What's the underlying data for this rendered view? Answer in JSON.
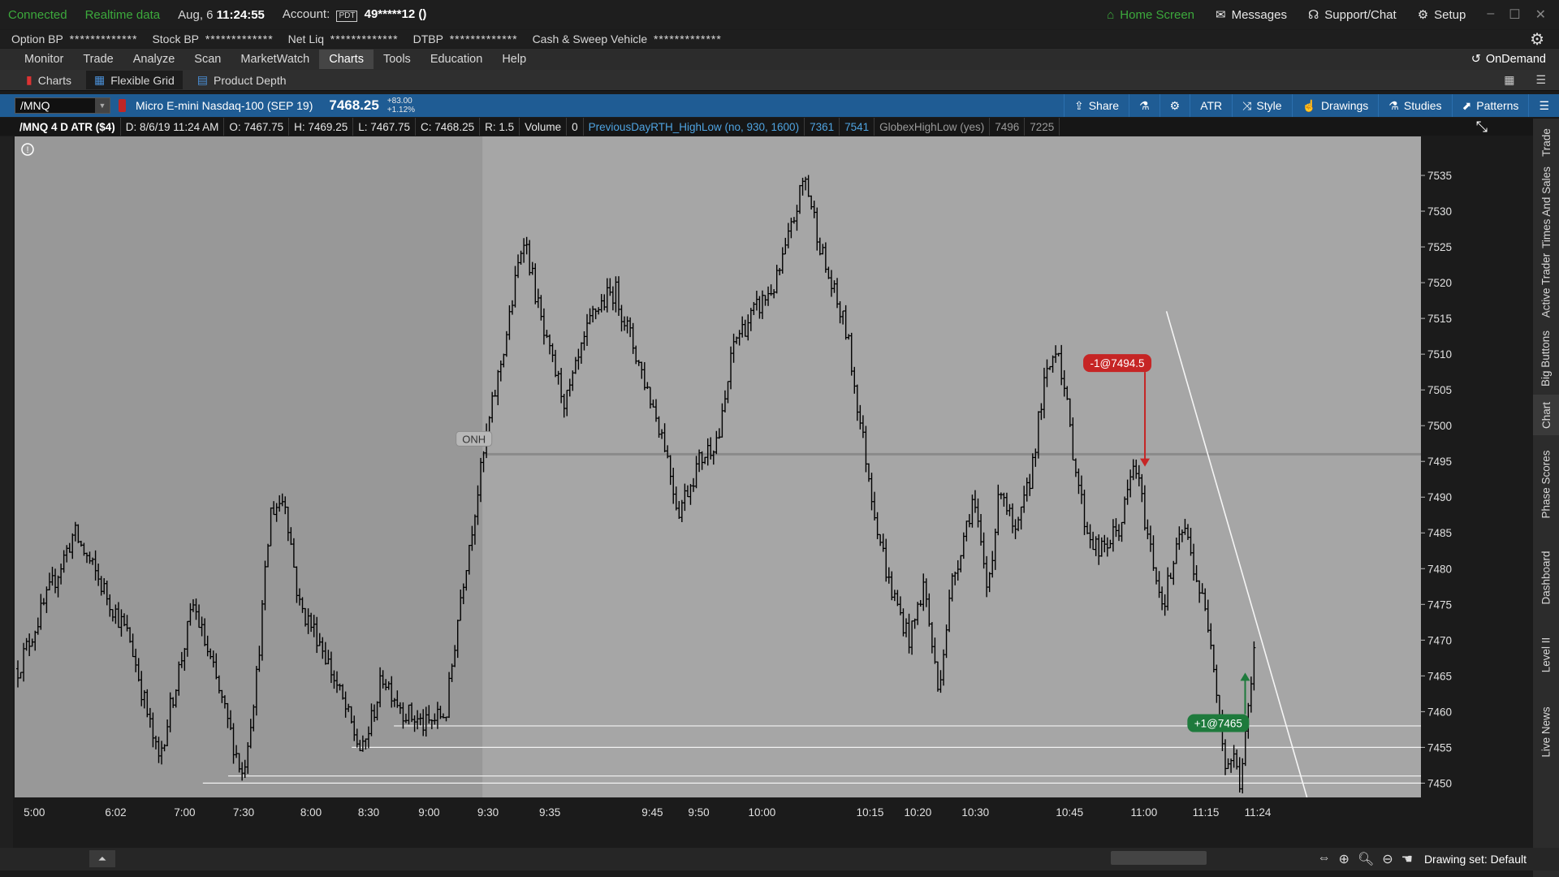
{
  "titlebar": {
    "connected": "Connected",
    "realtime": "Realtime data",
    "date": "Aug, 6",
    "time": "11:24:55",
    "account_label": "Account:",
    "pdt": "PDT",
    "account_value": "49*****12 ()",
    "home_screen": "Home Screen",
    "messages": "Messages",
    "support": "Support/Chat",
    "setup": "Setup"
  },
  "bpbar": {
    "items": [
      {
        "label": "Option BP",
        "value": "*************"
      },
      {
        "label": "Stock BP",
        "value": "*************"
      },
      {
        "label": "Net Liq",
        "value": "*************"
      },
      {
        "label": "DTBP",
        "value": "*************"
      },
      {
        "label": "Cash & Sweep Vehicle",
        "value": "*************"
      }
    ]
  },
  "nav": {
    "tabs": [
      "Monitor",
      "Trade",
      "Analyze",
      "Scan",
      "MarketWatch",
      "Charts",
      "Tools",
      "Education",
      "Help"
    ],
    "active": "Charts",
    "ondemand": "OnDemand"
  },
  "subnav": {
    "items": [
      "Charts",
      "Flexible Grid",
      "Product Depth"
    ],
    "active": "Flexible Grid"
  },
  "symbol": {
    "ticker": "/MNQ",
    "description": "Micro E-mini Nasdaq-100 (SEP 19)",
    "price": "7468.25",
    "change": "+83.00",
    "change_pct": "+1.12%",
    "tools": [
      "Share",
      "ATR",
      "Style",
      "Drawings",
      "Studies",
      "Patterns"
    ]
  },
  "info": {
    "title": "/MNQ 4 D ATR ($4)",
    "date": "D: 8/6/19 11:24 AM",
    "open": "O: 7467.75",
    "high": "H: 7469.25",
    "low": "L: 7467.75",
    "close": "C: 7468.25",
    "range": "R: 1.5",
    "volume_label": "Volume",
    "volume_value": "0",
    "study1": "PreviousDayRTH_HighLow (no, 930, 1600)",
    "study1_v1": "7361",
    "study1_v2": "7541",
    "study2": "GlobexHighLow (yes)",
    "study2_v1": "7496",
    "study2_v2": "7225"
  },
  "chart_data": {
    "type": "bar",
    "title": "",
    "y_ticks": [
      7450,
      7455,
      7460,
      7465,
      7470,
      7475,
      7480,
      7485,
      7490,
      7495,
      7500,
      7505,
      7510,
      7515,
      7520,
      7525,
      7530,
      7535
    ],
    "ylim": [
      7448,
      7540
    ],
    "x_ticks": [
      "5:00",
      "6:02",
      "7:00",
      "7:30",
      "8:00",
      "8:30",
      "9:00",
      "9:30",
      "9:35",
      "9:45",
      "9:50",
      "10:00",
      "10:15",
      "10:20",
      "10:30",
      "10:45",
      "11:00",
      "11:15",
      "11:24"
    ],
    "price_path": [
      [
        0,
        7466
      ],
      [
        0.04,
        7485
      ],
      [
        0.08,
        7470
      ],
      [
        0.1,
        7453
      ],
      [
        0.125,
        7475
      ],
      [
        0.14,
        7465
      ],
      [
        0.16,
        7451
      ],
      [
        0.17,
        7465
      ],
      [
        0.18,
        7488
      ],
      [
        0.19,
        7490
      ],
      [
        0.2,
        7475
      ],
      [
        0.215,
        7470
      ],
      [
        0.23,
        7462
      ],
      [
        0.245,
        7454
      ],
      [
        0.26,
        7465
      ],
      [
        0.275,
        7460
      ],
      [
        0.29,
        7458
      ],
      [
        0.305,
        7460
      ],
      [
        0.315,
        7476
      ],
      [
        0.325,
        7488
      ],
      [
        0.335,
        7500
      ],
      [
        0.35,
        7515
      ],
      [
        0.36,
        7527
      ],
      [
        0.375,
        7512
      ],
      [
        0.39,
        7503
      ],
      [
        0.41,
        7516
      ],
      [
        0.425,
        7519
      ],
      [
        0.44,
        7510
      ],
      [
        0.46,
        7498
      ],
      [
        0.47,
        7488
      ],
      [
        0.485,
        7495
      ],
      [
        0.5,
        7499
      ],
      [
        0.51,
        7512
      ],
      [
        0.525,
        7516
      ],
      [
        0.54,
        7520
      ],
      [
        0.55,
        7527
      ],
      [
        0.56,
        7535
      ],
      [
        0.575,
        7522
      ],
      [
        0.59,
        7513
      ],
      [
        0.6,
        7500
      ],
      [
        0.61,
        7488
      ],
      [
        0.62,
        7478
      ],
      [
        0.635,
        7470
      ],
      [
        0.645,
        7478
      ],
      [
        0.655,
        7463
      ],
      [
        0.665,
        7478
      ],
      [
        0.68,
        7490
      ],
      [
        0.69,
        7477
      ],
      [
        0.7,
        7492
      ],
      [
        0.71,
        7484
      ],
      [
        0.72,
        7492
      ],
      [
        0.73,
        7505
      ],
      [
        0.74,
        7512
      ],
      [
        0.75,
        7498
      ],
      [
        0.76,
        7486
      ],
      [
        0.77,
        7482
      ],
      [
        0.785,
        7486
      ],
      [
        0.795,
        7495
      ],
      [
        0.805,
        7484
      ],
      [
        0.815,
        7475
      ],
      [
        0.83,
        7486
      ],
      [
        0.84,
        7478
      ],
      [
        0.85,
        7470
      ],
      [
        0.855,
        7460
      ],
      [
        0.86,
        7452
      ],
      [
        0.865,
        7454
      ],
      [
        0.87,
        7450
      ],
      [
        0.875,
        7458
      ],
      [
        0.88,
        7468
      ]
    ],
    "onh_level": 7496,
    "onh_label": "ONH",
    "globex_high_tag": "7496",
    "last_price_tag": "7468.25",
    "support_levels": [
      7458,
      7455,
      7451,
      7450
    ],
    "trendline": {
      "from": [
        0.82,
        7516
      ],
      "to": [
        0.92,
        7448
      ]
    },
    "orders": [
      {
        "label": "-1@7494.5",
        "side": "sell",
        "price": 7494.5
      },
      {
        "label": "+1@7465",
        "side": "buy",
        "price": 7465
      }
    ]
  },
  "sidetabs": [
    "Trade",
    "Times And Sales",
    "Active Trader",
    "Big Buttons",
    "Chart",
    "Phase Scores",
    "Dashboard",
    "Level II",
    "Live News"
  ],
  "bottom": {
    "drawing_set": "Drawing set: Default"
  },
  "colors": {
    "accent_blue": "#1f5c94",
    "connected_green": "#3ca93c",
    "sell_red": "#c62525",
    "buy_green": "#1e7a3c",
    "chart_bg": "#a6a6a6",
    "chart_pre_bg": "#989898"
  }
}
